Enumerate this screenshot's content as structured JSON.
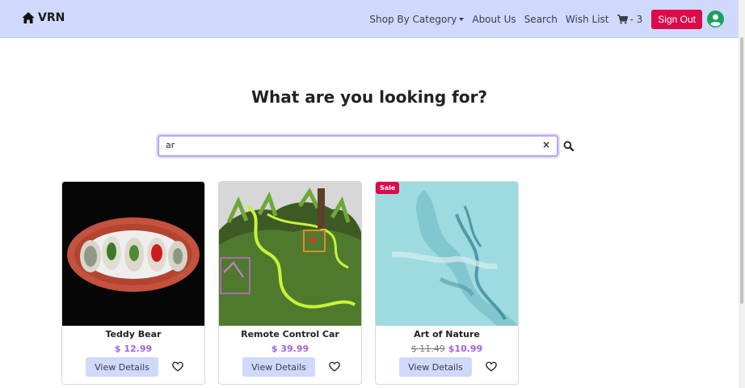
{
  "nav": {
    "brand": "VRN",
    "category": "Shop By Category",
    "about": "About Us",
    "search": "Search",
    "wishlist": "Wish List",
    "cart_count": "- 3",
    "signout": "Sign Out"
  },
  "page": {
    "title": "What are you looking for?"
  },
  "search": {
    "value": "ar",
    "clear": "×"
  },
  "products": [
    {
      "name": "Teddy Bear",
      "price": "$ 12.99",
      "button": "View Details"
    },
    {
      "name": "Remote Control Car",
      "price": "$ 39.99",
      "button": "View Details"
    },
    {
      "name": "Art of Nature",
      "old_price": "$ 11.49",
      "price": "$10.99",
      "button": "View Details",
      "badge": "Sale"
    }
  ],
  "colors": {
    "navbar": "#cfd9fb",
    "signout": "#dc0a4a",
    "price": "#a065d8",
    "avatar": "#1aa05a",
    "search_border": "#b8a6ee"
  },
  "icons": [
    "home-icon",
    "cart-icon",
    "user-avatar-icon",
    "close-icon",
    "search-icon",
    "heart-icon"
  ]
}
